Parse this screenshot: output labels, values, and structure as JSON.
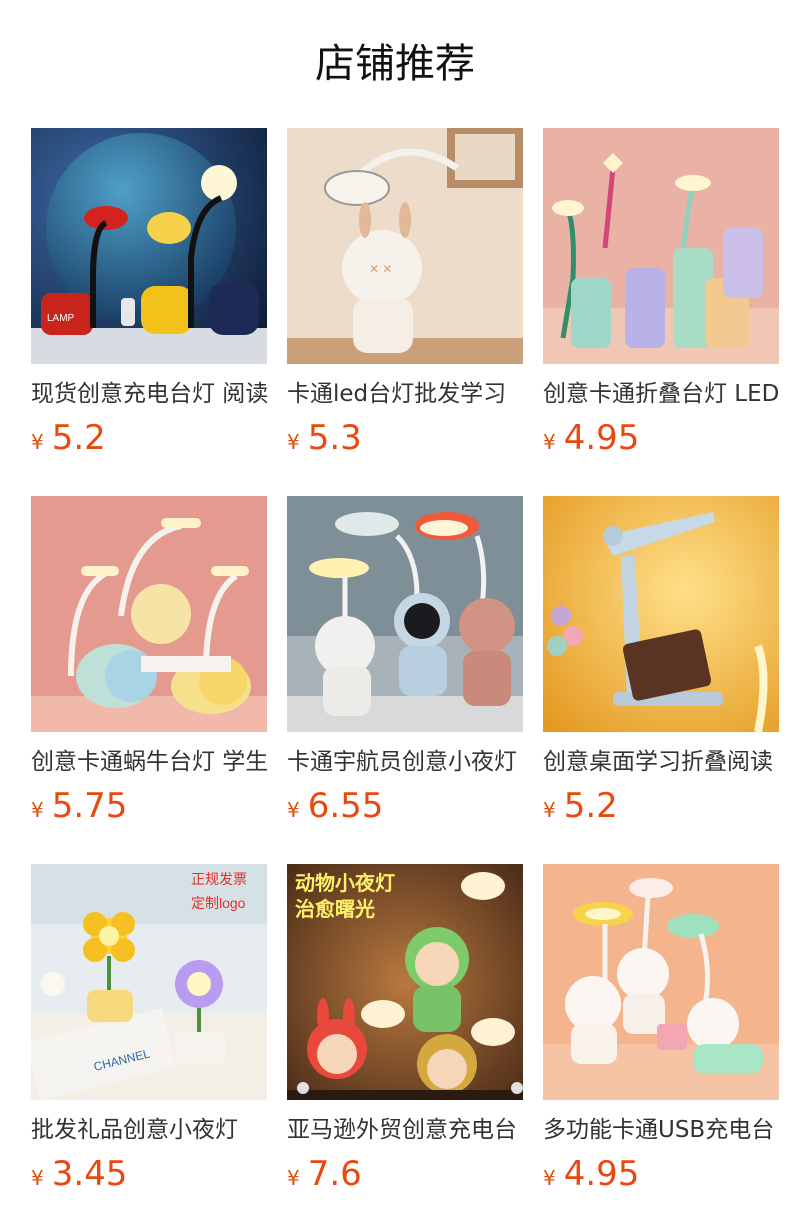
{
  "title": "店铺推荐",
  "currency": "¥",
  "products": [
    {
      "name": "现货创意充电台灯 阅读",
      "price": "5.2"
    },
    {
      "name": "卡通led台灯批发学习",
      "price": "5.3"
    },
    {
      "name": "创意卡通折叠台灯 LED",
      "price": "4.95"
    },
    {
      "name": "创意卡通蜗牛台灯 学生",
      "price": "5.75"
    },
    {
      "name": "卡通宇航员创意小夜灯",
      "price": "6.55"
    },
    {
      "name": "创意桌面学习折叠阅读",
      "price": "5.2"
    },
    {
      "name": "批发礼品创意小夜灯",
      "price": "3.45"
    },
    {
      "name": "亚马逊外贸创意充电台",
      "price": "7.6"
    },
    {
      "name": "多功能卡通USB充电台",
      "price": "4.95"
    }
  ],
  "image_text": {
    "p1_logo": "LAMP",
    "p7_tag1": "正规发票",
    "p7_tag2": "定制logo",
    "p7_book": "CHANNEL",
    "p8_title1": "动物小夜灯",
    "p8_title2": "治愈曙光"
  }
}
